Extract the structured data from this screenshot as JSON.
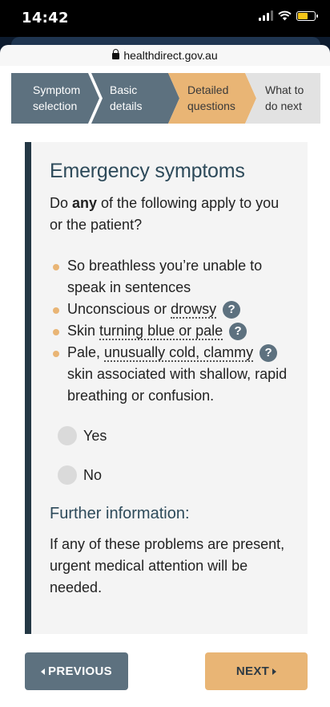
{
  "status_bar": {
    "time": "14:42"
  },
  "browser": {
    "url": "healthdirect.gov.au"
  },
  "steps": [
    {
      "line1": "Symptom",
      "line2": "selection"
    },
    {
      "line1": "Basic",
      "line2": "details"
    },
    {
      "line1": "Detailed",
      "line2": "questions"
    },
    {
      "line1": "What to",
      "line2": "do next"
    }
  ],
  "panel": {
    "title": "Emergency symptoms",
    "question_pre": "Do ",
    "question_bold": "any",
    "question_post": " of the following apply to you or the patient?",
    "symptoms": {
      "s1": "So breathless you’re unable to speak in sentences",
      "s2_pre": "Unconscious or ",
      "s2_term": "drowsy",
      "s3_pre": "Skin ",
      "s3_term": "turning blue or pale",
      "s4_pre": "Pale, ",
      "s4_term": "unusually cold, clammy",
      "s4_post": " skin associated with shallow, rapid breathing or confusion."
    },
    "help_icon_glyph": "?",
    "options": {
      "yes": "Yes",
      "no": "No"
    },
    "further_title": "Further information:",
    "further_text": "If any of these problems are present, urgent medical attention will be needed."
  },
  "buttons": {
    "previous": "PREVIOUS",
    "next": "NEXT"
  },
  "colors": {
    "slate": "#5d717f",
    "accent": "#e9b575",
    "dark_bar": "#243845",
    "heading": "#2d4a5a"
  },
  "icons": {
    "lock": "lock-icon",
    "help": "help-icon",
    "prev": "triangle-left-icon",
    "next": "triangle-right-icon"
  }
}
